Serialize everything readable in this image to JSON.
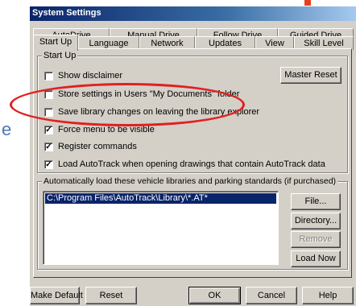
{
  "window": {
    "title": "System Settings"
  },
  "side_text": "e",
  "tabs": {
    "row1": [
      "AutoDrive",
      "Manual Drive",
      "Follow Drive",
      "Guided Drive"
    ],
    "row2": [
      "Start Up",
      "Language",
      "Network",
      "Updates",
      "View",
      "Skill Level"
    ],
    "active": "Start Up"
  },
  "startup_group": {
    "label": "Start Up",
    "checkboxes": [
      {
        "label": "Show disclaimer",
        "checked": false
      },
      {
        "label": "Store settings in Users \"My Documents\" folder",
        "checked": false
      },
      {
        "label": "Save library changes on leaving the library explorer",
        "checked": false
      },
      {
        "label": "Force menu to be visible",
        "checked": true
      },
      {
        "label": "Register commands",
        "checked": true
      },
      {
        "label": "Load AutoTrack when opening drawings that contain AutoTrack data",
        "checked": true
      }
    ],
    "master_reset": "Master Reset"
  },
  "libraries_group": {
    "label": "Automatically load these vehicle libraries and parking standards (if purchased)",
    "items": [
      "C:\\Program Files\\AutoTrack\\Library\\*.AT*"
    ],
    "buttons": {
      "file": "File...",
      "directory": "Directory...",
      "remove": "Remove",
      "load_now": "Load Now"
    }
  },
  "footer": {
    "make_default": "Make Default",
    "reset": "Reset",
    "ok": "OK",
    "cancel": "Cancel",
    "help": "Help"
  },
  "colors": {
    "title_bar": "#0a246a",
    "dialog_bg": "#d4d0c8",
    "highlight_ellipse": "#e02020",
    "selection": "#0a246a"
  }
}
